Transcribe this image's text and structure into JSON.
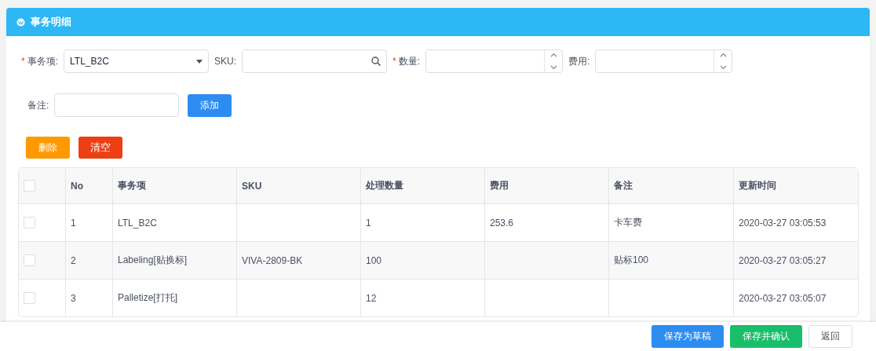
{
  "panel": {
    "title": "事务明细"
  },
  "form": {
    "item": {
      "required_mark": "*",
      "label": "事务项:",
      "value": "LTL_B2C"
    },
    "sku": {
      "label": "SKU:"
    },
    "quantity": {
      "required_mark": "*",
      "label": "数量:"
    },
    "fee": {
      "label": "费用:"
    },
    "remark": {
      "label": "备注:"
    },
    "add_button": "添加"
  },
  "actions": [
    "删除",
    "清空"
  ],
  "table": {
    "header_checked": false,
    "columns": [
      "No",
      "事务项",
      "SKU",
      "处理数量",
      "费用",
      "备注",
      "更新时间"
    ],
    "rows": [
      {
        "checked": false,
        "cells": [
          "1",
          "LTL_B2C",
          "",
          "1",
          "253.6",
          "卡车费",
          "2020-03-27 03:05:53"
        ]
      },
      {
        "checked": false,
        "cells": [
          "2",
          "Labeling[贴换标]",
          "VIVA-2809-BK",
          "100",
          "",
          "贴标100",
          "2020-03-27 03:05:27"
        ]
      },
      {
        "checked": false,
        "cells": [
          "3",
          "Palletize[打托]",
          "",
          "12",
          "",
          "",
          "2020-03-27 03:05:07"
        ]
      }
    ]
  },
  "footer": [
    {
      "label": "保存为草稿",
      "kind": "primary"
    },
    {
      "label": "保存并确认",
      "kind": "success"
    },
    {
      "label": "返回",
      "kind": "default"
    }
  ]
}
